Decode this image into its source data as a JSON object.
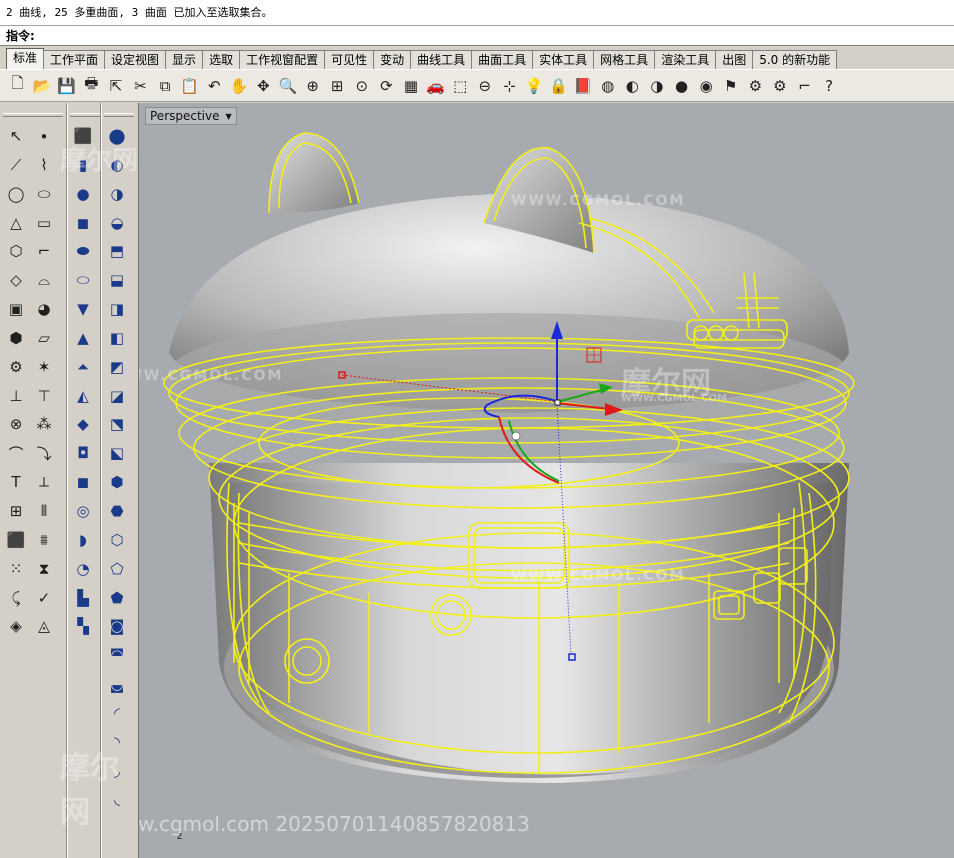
{
  "command": {
    "history": "2 曲线, 25 多重曲面, 3 曲面 已加入至选取集合。",
    "prompt_label": "指令:",
    "input_value": ""
  },
  "tabs": [
    "标准",
    "工作平面",
    "设定视图",
    "显示",
    "选取",
    "工作视窗配置",
    "可见性",
    "变动",
    "曲线工具",
    "曲面工具",
    "实体工具",
    "网格工具",
    "渲染工具",
    "出图",
    "5.0 的新功能"
  ],
  "active_tab": "标准",
  "toolbar_icons": [
    {
      "name": "new-file-icon",
      "glyph": "🗋"
    },
    {
      "name": "open-file-icon",
      "glyph": "📂"
    },
    {
      "name": "save-icon",
      "glyph": "💾"
    },
    {
      "name": "print-icon",
      "glyph": "🖶"
    },
    {
      "name": "import-icon",
      "glyph": "⇱"
    },
    {
      "name": "cut-icon",
      "glyph": "✂"
    },
    {
      "name": "copy-icon",
      "glyph": "⧉"
    },
    {
      "name": "paste-icon",
      "glyph": "📋"
    },
    {
      "name": "undo-icon",
      "glyph": "↶"
    },
    {
      "name": "pan-hand-icon",
      "glyph": "✋"
    },
    {
      "name": "move-view-icon",
      "glyph": "✥"
    },
    {
      "name": "zoom-icon",
      "glyph": "🔍"
    },
    {
      "name": "zoom-window-icon",
      "glyph": "⊕"
    },
    {
      "name": "zoom-extents-icon",
      "glyph": "⊞"
    },
    {
      "name": "zoom-selected-icon",
      "glyph": "⊙"
    },
    {
      "name": "rotate-view-icon",
      "glyph": "⟳"
    },
    {
      "name": "four-viewports-icon",
      "glyph": "▦"
    },
    {
      "name": "car-icon",
      "glyph": "🚗"
    },
    {
      "name": "cplane-icon",
      "glyph": "⬚"
    },
    {
      "name": "snap-icon",
      "glyph": "⊖"
    },
    {
      "name": "grid-snap-icon",
      "glyph": "⊹"
    },
    {
      "name": "light-bulb-icon",
      "glyph": "💡"
    },
    {
      "name": "lock-icon",
      "glyph": "🔒"
    },
    {
      "name": "layer-icon",
      "glyph": "📕"
    },
    {
      "name": "color-wheel-icon",
      "glyph": "◍"
    },
    {
      "name": "shaded-sphere-icon",
      "glyph": "◐"
    },
    {
      "name": "ghosted-sphere-icon",
      "glyph": "◑"
    },
    {
      "name": "render-sphere-icon",
      "glyph": "●"
    },
    {
      "name": "material-sphere-icon",
      "glyph": "◉"
    },
    {
      "name": "flag-icon",
      "glyph": "⚑"
    },
    {
      "name": "settings-gears-icon",
      "glyph": "⚙"
    },
    {
      "name": "options-icon",
      "glyph": "⚙"
    },
    {
      "name": "grasshopper-icon",
      "glyph": "⌐"
    },
    {
      "name": "help-icon",
      "glyph": "?"
    }
  ],
  "left_tools_col1": [
    {
      "name": "select-icon",
      "glyph": "↖"
    },
    {
      "name": "point-icon",
      "glyph": "∙"
    },
    {
      "name": "polyline-icon",
      "glyph": "⟋"
    },
    {
      "name": "curve-control-icon",
      "glyph": "⌇"
    },
    {
      "name": "circle-icon",
      "glyph": "◯"
    },
    {
      "name": "ellipse-icon",
      "glyph": "⬭"
    },
    {
      "name": "triangle-icon",
      "glyph": "△"
    },
    {
      "name": "rectangle-icon",
      "glyph": "▭"
    },
    {
      "name": "polygon-icon",
      "glyph": "⬡"
    },
    {
      "name": "fillet-curve-icon",
      "glyph": "⌐"
    },
    {
      "name": "surface-edge-icon",
      "glyph": "◇"
    },
    {
      "name": "loft-icon",
      "glyph": "⌓"
    },
    {
      "name": "box-solid-icon",
      "glyph": "▣"
    },
    {
      "name": "sphere-solid-icon",
      "glyph": "◕"
    },
    {
      "name": "extrude-icon",
      "glyph": "⬢"
    },
    {
      "name": "plane-surface-icon",
      "glyph": "▱"
    },
    {
      "name": "transform-gear-icon",
      "glyph": "⚙"
    },
    {
      "name": "explode-icon",
      "glyph": "✶"
    },
    {
      "name": "trim-icon",
      "glyph": "⊥"
    },
    {
      "name": "split-icon",
      "glyph": "⊤"
    },
    {
      "name": "boolean-icon",
      "glyph": "⊗"
    },
    {
      "name": "group-icon",
      "glyph": "⁂"
    },
    {
      "name": "arc-icon",
      "glyph": "⌒"
    },
    {
      "name": "offset-curve-icon",
      "glyph": "⤵"
    },
    {
      "name": "text-icon",
      "glyph": "T"
    },
    {
      "name": "dimension-icon",
      "glyph": "⟂"
    },
    {
      "name": "array-icon",
      "glyph": "⊞"
    },
    {
      "name": "mirror-icon",
      "glyph": "⫴"
    },
    {
      "name": "block-icon",
      "glyph": "⬛"
    },
    {
      "name": "render-mesh-icon",
      "glyph": "⩩"
    },
    {
      "name": "point-grid-icon",
      "glyph": "⁙"
    },
    {
      "name": "history-icon",
      "glyph": "⧗"
    },
    {
      "name": "bend-icon",
      "glyph": "⤹"
    },
    {
      "name": "check-icon",
      "glyph": "✓"
    },
    {
      "name": "analyze-icon",
      "glyph": "◈"
    },
    {
      "name": "drape-icon",
      "glyph": "◬"
    }
  ],
  "left_tools_col2": [
    {
      "name": "box-icon",
      "glyph": "⬛"
    },
    {
      "name": "cylinder-icon",
      "glyph": "▮"
    },
    {
      "name": "sphere-icon",
      "glyph": "●"
    },
    {
      "name": "cube-blue-icon",
      "glyph": "◼"
    },
    {
      "name": "ellipsoid-icon",
      "glyph": "⬬"
    },
    {
      "name": "torus-flat-icon",
      "glyph": "⬭"
    },
    {
      "name": "paraboloid-icon",
      "glyph": "▼"
    },
    {
      "name": "cone-icon",
      "glyph": "▲"
    },
    {
      "name": "truncated-cone-icon",
      "glyph": "⏶"
    },
    {
      "name": "pyramid-icon",
      "glyph": "◭"
    },
    {
      "name": "wedge-icon",
      "glyph": "◆"
    },
    {
      "name": "tube-icon",
      "glyph": "◘"
    },
    {
      "name": "solid-cube-icon",
      "glyph": "◼"
    },
    {
      "name": "torus-icon",
      "glyph": "◎"
    },
    {
      "name": "pipe-icon",
      "glyph": "◗"
    },
    {
      "name": "rail-revolve-icon",
      "glyph": "◔"
    },
    {
      "name": "slab-icon",
      "glyph": "▙"
    },
    {
      "name": "cap-icon",
      "glyph": "▚"
    }
  ],
  "left_tools_col3": [
    {
      "name": "boolean-union-icon",
      "glyph": "⬤"
    },
    {
      "name": "boolean-diff-icon",
      "glyph": "◐"
    },
    {
      "name": "boolean-intersect-icon",
      "glyph": "◑"
    },
    {
      "name": "boolean-split-icon",
      "glyph": "◒"
    },
    {
      "name": "extrude-face-icon",
      "glyph": "⬒"
    },
    {
      "name": "cap-planar-icon",
      "glyph": "⬓"
    },
    {
      "name": "extract-surface-icon",
      "glyph": "◨"
    },
    {
      "name": "shell-icon",
      "glyph": "◧"
    },
    {
      "name": "solid-fillet-icon",
      "glyph": "◩"
    },
    {
      "name": "solid-chamfer-icon",
      "glyph": "◪"
    },
    {
      "name": "move-face-icon",
      "glyph": "⬔"
    },
    {
      "name": "wire-cut-icon",
      "glyph": "⬕"
    },
    {
      "name": "thicken-icon",
      "glyph": "⬢"
    },
    {
      "name": "move-edge-icon",
      "glyph": "⬣"
    },
    {
      "name": "split-edge-icon",
      "glyph": "⬡"
    },
    {
      "name": "merge-edge-icon",
      "glyph": "⬠"
    },
    {
      "name": "solid-edit-icon",
      "glyph": "⬟"
    },
    {
      "name": "make-hole-icon",
      "glyph": "◙"
    },
    {
      "name": "rotate-face-icon",
      "glyph": "◚"
    },
    {
      "name": "move-hole-icon",
      "glyph": "◛"
    },
    {
      "name": "array-hole-icon",
      "glyph": "◜"
    },
    {
      "name": "delete-hole-icon",
      "glyph": "◝"
    },
    {
      "name": "extrude-taper-icon",
      "glyph": "◞"
    },
    {
      "name": "extra-solid-icon",
      "glyph": "◟"
    }
  ],
  "viewport": {
    "label": "Perspective",
    "watermarks": {
      "big": "摩尔网",
      "small": "WWW.CGMOL.COM",
      "url": "WWW.CGMOL.COM",
      "bottom": "摩尔网 www.cgmol.com 20250701140857820813"
    },
    "axis_z": "z"
  },
  "colors": {
    "viewport_bg": "#a7abb0",
    "selection_yellow": "#f2ef1a",
    "gumball_x": "#e01818",
    "gumball_y": "#1aa81a",
    "gumball_z": "#1a2ad8"
  }
}
